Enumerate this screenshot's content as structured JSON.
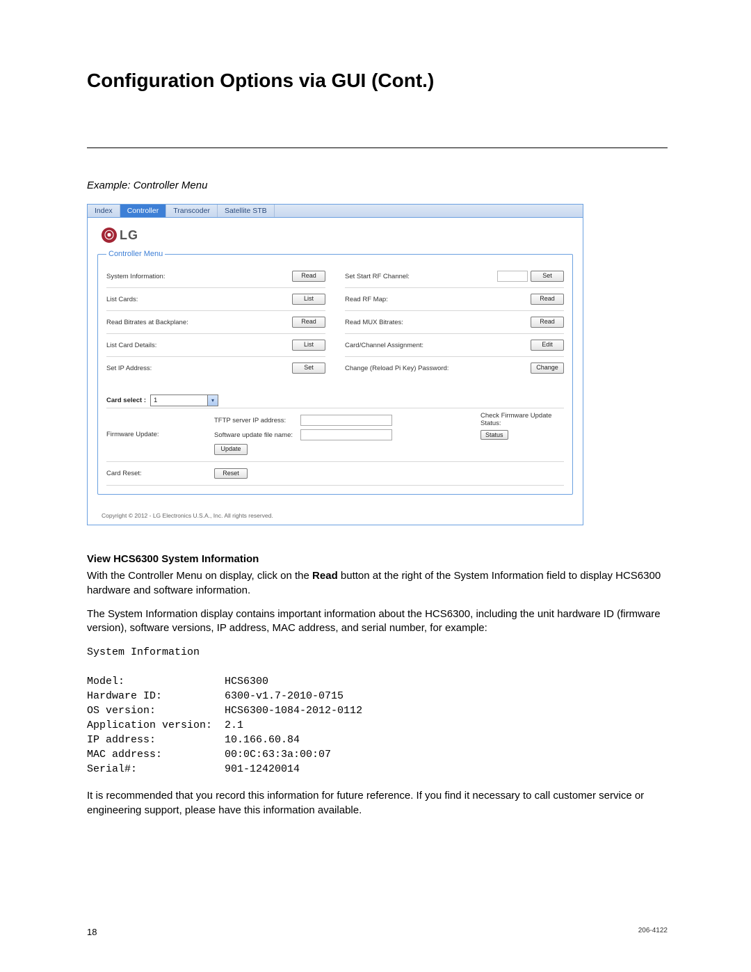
{
  "page_title": "Configuration Options via GUI (Cont.)",
  "example_label": "Example: Controller Menu",
  "tabs": {
    "index": "Index",
    "controller": "Controller",
    "transcoder": "Transcoder",
    "satellite": "Satellite STB"
  },
  "logo_text": "LG",
  "fieldset_title": "Controller Menu",
  "left_rows": [
    {
      "label": "System Information:",
      "button": "Read"
    },
    {
      "label": "List Cards:",
      "button": "List"
    },
    {
      "label": "Read Bitrates at Backplane:",
      "button": "Read"
    },
    {
      "label": "List Card Details:",
      "button": "List"
    },
    {
      "label": "Set IP Address:",
      "button": "Set"
    }
  ],
  "right_rows": [
    {
      "label": "Set Start RF Channel:",
      "button": "Set",
      "has_input": true
    },
    {
      "label": "Read RF Map:",
      "button": "Read"
    },
    {
      "label": "Read MUX Bitrates:",
      "button": "Read"
    },
    {
      "label": "Card/Channel Assignment:",
      "button": "Edit"
    },
    {
      "label": "Change (Reload Pi Key) Password:",
      "button": "Change"
    }
  ],
  "card_select_label": "Card select :",
  "card_select_value": "1",
  "firmware": {
    "label": "Firmware Update:",
    "tftp_label": "TFTP server IP address:",
    "swfile_label": "Software update file name:",
    "update_btn": "Update",
    "check_line1": "Check Firmware Update",
    "check_line2": "Status:",
    "status_btn": "Status"
  },
  "card_reset": {
    "label": "Card Reset:",
    "button": "Reset"
  },
  "copyright": "Copyright © 2012 - LG Electronics U.S.A., Inc. All rights reserved.",
  "section_heading": "View HCS6300 System Information",
  "para1_pre": "With the Controller Menu on display, click on the ",
  "para1_bold": "Read",
  "para1_post": " button at the right of the System Information field to display HCS6300 hardware and software information.",
  "para2": "The System Information display contains important information about the HCS6300, including the unit hardware ID (firmware version), software versions, IP address, MAC address, and serial number, for example:",
  "sysinfo_title": "System Information",
  "sysinfo": {
    "model_l": "Model:",
    "model_v": "HCS6300",
    "hw_l": "Hardware ID:",
    "hw_v": "6300-v1.7-2010-0715",
    "os_l": "OS version:",
    "os_v": "HCS6300-1084-2012-0112",
    "app_l": "Application version:",
    "app_v": "2.1",
    "ip_l": "IP address:",
    "ip_v": "10.166.60.84",
    "mac_l": "MAC address:",
    "mac_v": "00:0C:63:3a:00:07",
    "ser_l": "Serial#:",
    "ser_v": "901-12420014"
  },
  "para3": "It is recommended that you record this information for future reference. If you find it necessary to call customer service or engineering support, please have this information available.",
  "page_number": "18",
  "doc_number": "206-4122"
}
